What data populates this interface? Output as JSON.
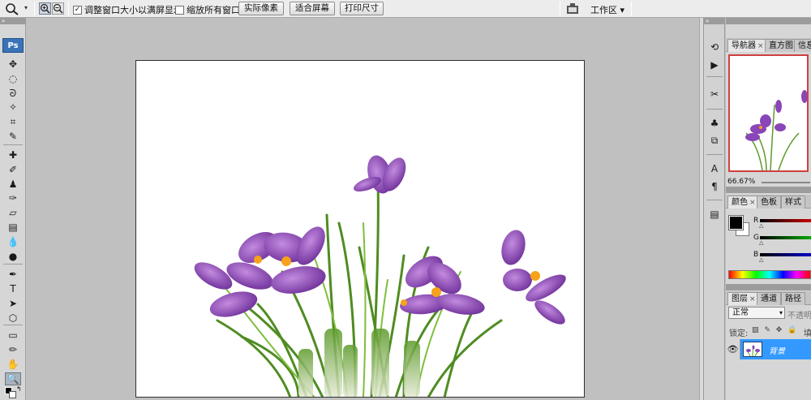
{
  "options_bar": {
    "tool_icon": "zoom-tool-icon",
    "resize_windows_label": "调整窗口大小以满屏显示",
    "resize_windows_checked": true,
    "zoom_all_windows_label": "缩放所有窗口",
    "zoom_all_windows_checked": false,
    "buttons": {
      "actual_pixels": "实际像素",
      "fit_screen": "适合屏幕",
      "print_size": "打印尺寸"
    },
    "workspace_label": "工作区 ▾"
  },
  "toolbox": {
    "logo": "Ps",
    "tools": [
      {
        "name": "move-tool-icon",
        "glyph": "✥"
      },
      {
        "name": "marquee-tool-icon",
        "glyph": "◌"
      },
      {
        "name": "lasso-tool-icon",
        "glyph": "ᘐ"
      },
      {
        "name": "magic-wand-tool-icon",
        "glyph": "✧"
      },
      {
        "name": "crop-tool-icon",
        "glyph": "⌗"
      },
      {
        "name": "slice-tool-icon",
        "glyph": "✎"
      },
      {
        "name": "healing-brush-tool-icon",
        "glyph": "✚"
      },
      {
        "name": "brush-tool-icon",
        "glyph": "✐"
      },
      {
        "name": "clone-stamp-tool-icon",
        "glyph": "♟"
      },
      {
        "name": "history-brush-tool-icon",
        "glyph": "✑"
      },
      {
        "name": "eraser-tool-icon",
        "glyph": "▱"
      },
      {
        "name": "gradient-tool-icon",
        "glyph": "▤"
      },
      {
        "name": "blur-tool-icon",
        "glyph": "💧"
      },
      {
        "name": "dodge-tool-icon",
        "glyph": "●"
      },
      {
        "name": "pen-tool-icon",
        "glyph": "✒"
      },
      {
        "name": "type-tool-icon",
        "glyph": "T"
      },
      {
        "name": "path-selection-tool-icon",
        "glyph": "➤"
      },
      {
        "name": "shape-tool-icon",
        "glyph": "⬡"
      },
      {
        "name": "notes-tool-icon",
        "glyph": "▭"
      },
      {
        "name": "eyedropper-tool-icon",
        "glyph": "✏"
      },
      {
        "name": "hand-tool-icon",
        "glyph": "✋"
      },
      {
        "name": "zoom-tool-icon",
        "glyph": "🔍"
      }
    ]
  },
  "dock": {
    "icons": [
      "history-icon",
      "actions-icon",
      "tool-presets-icon",
      "brushes-icon",
      "clone-source-icon",
      "character-icon",
      "paragraph-icon",
      "layer-comps-icon"
    ]
  },
  "navigator_panel": {
    "tabs": [
      "导航器",
      "直方图",
      "信息"
    ],
    "zoom": "66.67%"
  },
  "color_panel": {
    "tabs": [
      "颜色",
      "色板",
      "样式"
    ],
    "channels": [
      "R",
      "G",
      "B"
    ],
    "colors": {
      "r": "#cc0000",
      "g": "#00aa00",
      "b": "#0000cc"
    }
  },
  "layers_panel": {
    "tabs": [
      "图层",
      "通道",
      "路径"
    ],
    "blend_mode": "正常",
    "opacity_label": "不透明",
    "lock_label": "锁定:",
    "fill_label": "填",
    "layer_name": "背景"
  },
  "accent": "#3399ff"
}
